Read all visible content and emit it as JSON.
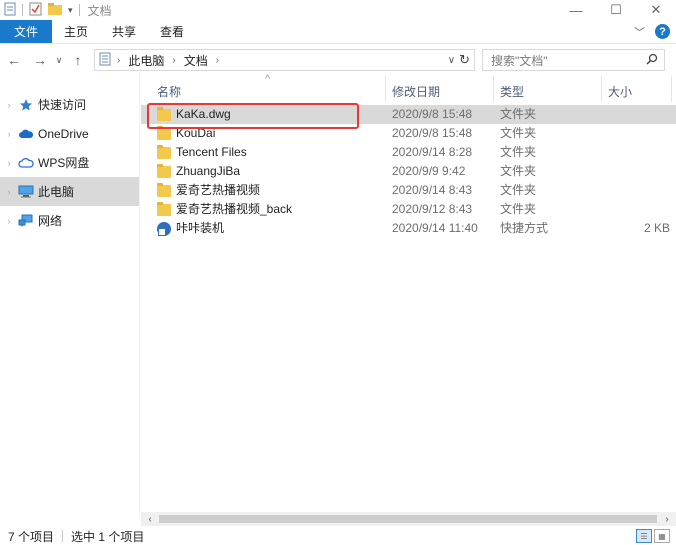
{
  "window": {
    "title": "文档",
    "controls": {
      "minimize": "—",
      "maximize": "☐",
      "close": "✕"
    }
  },
  "ribbon": {
    "tabs": [
      "文件",
      "主页",
      "共享",
      "查看"
    ],
    "expand_icon": "chevron-down-icon",
    "help_label": "?"
  },
  "address": {
    "crumbs": [
      "此电脑",
      "文档"
    ],
    "search_placeholder": "搜索\"文档\""
  },
  "nav": {
    "items": [
      {
        "label": "快速访问",
        "icon": "star-icon"
      },
      {
        "label": "OneDrive",
        "icon": "cloud-icon"
      },
      {
        "label": "WPS网盘",
        "icon": "cloud-outline-icon"
      },
      {
        "label": "此电脑",
        "icon": "computer-icon"
      },
      {
        "label": "网络",
        "icon": "network-icon"
      }
    ]
  },
  "columns": {
    "name": "名称",
    "date": "修改日期",
    "type": "类型",
    "size": "大小"
  },
  "files": [
    {
      "name": "KaKa.dwg",
      "date": "2020/9/8 15:48",
      "type": "文件夹",
      "size": "",
      "icon": "folder-icon"
    },
    {
      "name": "KouDai",
      "date": "2020/9/8 15:48",
      "type": "文件夹",
      "size": "",
      "icon": "folder-icon"
    },
    {
      "name": "Tencent Files",
      "date": "2020/9/14 8:28",
      "type": "文件夹",
      "size": "",
      "icon": "folder-icon"
    },
    {
      "name": "ZhuangJiBa",
      "date": "2020/9/9 9:42",
      "type": "文件夹",
      "size": "",
      "icon": "folder-icon"
    },
    {
      "name": "爱奇艺热播视频",
      "date": "2020/9/14 8:43",
      "type": "文件夹",
      "size": "",
      "icon": "folder-icon"
    },
    {
      "name": "爱奇艺热播视频_back",
      "date": "2020/9/12 8:43",
      "type": "文件夹",
      "size": "",
      "icon": "folder-icon"
    },
    {
      "name": "咔咔装机",
      "date": "2020/9/14 11:40",
      "type": "快捷方式",
      "size": "2 KB",
      "icon": "shortcut-icon"
    }
  ],
  "status": {
    "item_count": "7 个项目",
    "selected_count": "选中 1 个项目"
  },
  "colors": {
    "accent": "#1979ca",
    "selection": "#d9d9d9",
    "highlight_box": "#e53935"
  }
}
